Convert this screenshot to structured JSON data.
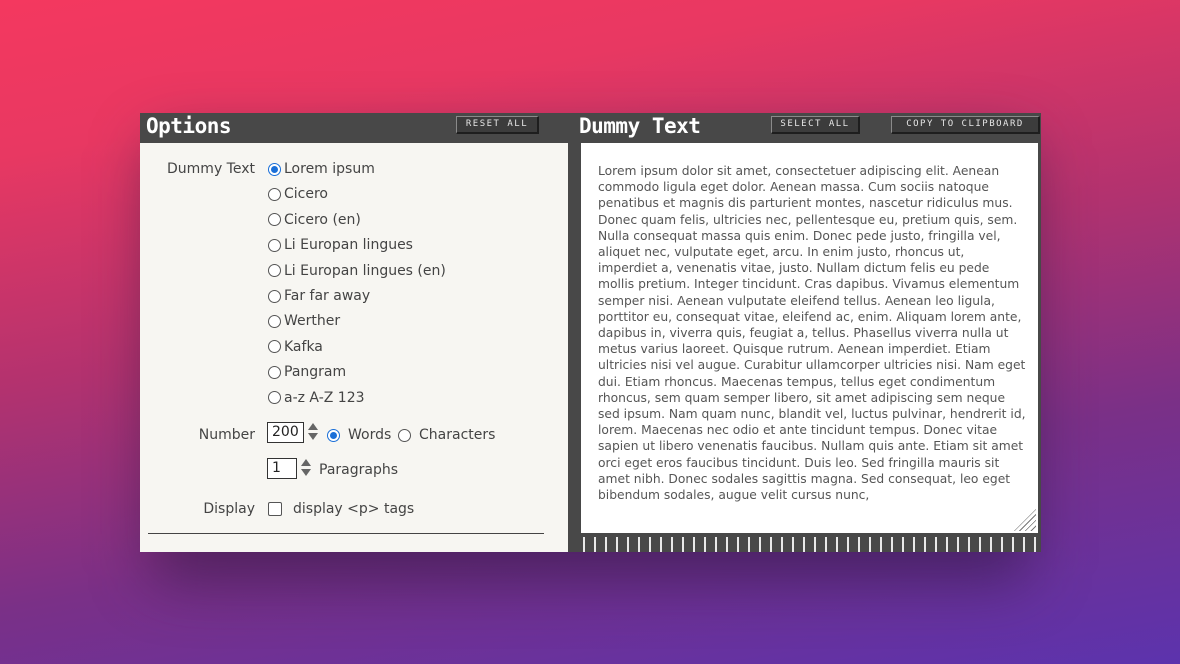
{
  "options": {
    "title": "Options",
    "reset_label": "RESET ALL",
    "dummy_text_label": "Dummy Text",
    "sources": [
      {
        "label": "Lorem ipsum",
        "checked": true
      },
      {
        "label": "Cicero",
        "checked": false
      },
      {
        "label": "Cicero (en)",
        "checked": false
      },
      {
        "label": "Li Europan lingues",
        "checked": false
      },
      {
        "label": "Li Europan lingues (en)",
        "checked": false
      },
      {
        "label": "Far far away",
        "checked": false
      },
      {
        "label": "Werther",
        "checked": false
      },
      {
        "label": "Kafka",
        "checked": false
      },
      {
        "label": "Pangram",
        "checked": false
      },
      {
        "label": "a-z A-Z 123",
        "checked": false
      }
    ],
    "number_label": "Number",
    "number_value": "200",
    "unit_words": "Words",
    "unit_characters": "Characters",
    "unit_selected": "Words",
    "paragraphs_value": "1",
    "paragraphs_label": "Paragraphs",
    "display_label": "Display",
    "display_ptags_label": "display <p> tags",
    "display_ptags_checked": false
  },
  "output": {
    "title": "Dummy Text",
    "select_all_label": "SELECT ALL",
    "copy_label": "COPY TO CLIPBOARD",
    "text": "Lorem ipsum dolor sit amet, consectetuer adipiscing elit. Aenean commodo ligula eget dolor. Aenean massa. Cum sociis natoque penatibus et magnis dis parturient montes, nascetur ridiculus mus. Donec quam felis, ultricies nec, pellentesque eu, pretium quis, sem. Nulla consequat massa quis enim. Donec pede justo, fringilla vel, aliquet nec, vulputate eget, arcu. In enim justo, rhoncus ut, imperdiet a, venenatis vitae, justo. Nullam dictum felis eu pede mollis pretium. Integer tincidunt. Cras dapibus. Vivamus elementum semper nisi. Aenean vulputate eleifend tellus. Aenean leo ligula, porttitor eu, consequat vitae, eleifend ac, enim. Aliquam lorem ante, dapibus in, viverra quis, feugiat a, tellus. Phasellus viverra nulla ut metus varius laoreet. Quisque rutrum. Aenean imperdiet. Etiam ultricies nisi vel augue. Curabitur ullamcorper ultricies nisi. Nam eget dui. Etiam rhoncus. Maecenas tempus, tellus eget condimentum rhoncus, sem quam semper libero, sit amet adipiscing sem neque sed ipsum. Nam quam nunc, blandit vel, luctus pulvinar, hendrerit id, lorem. Maecenas nec odio et ante tincidunt tempus. Donec vitae sapien ut libero venenatis faucibus. Nullam quis ante. Etiam sit amet orci eget eros faucibus tincidunt. Duis leo. Sed fringilla mauris sit amet nibh. Donec sodales sagittis magna. Sed consequat, leo eget bibendum sodales, augue velit cursus nunc,"
  }
}
